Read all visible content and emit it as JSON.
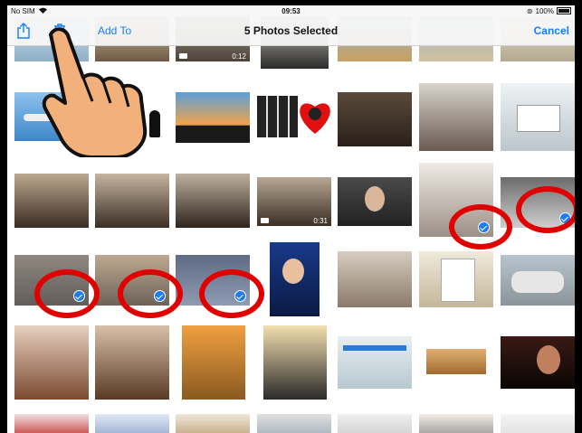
{
  "status": {
    "carrier": "No SIM",
    "time": "09:53",
    "battery": "100%"
  },
  "navbar": {
    "add_label": "Add To",
    "title": "5 Photos Selected",
    "cancel_label": "Cancel",
    "share_icon": "share-icon",
    "trash_icon": "trash-icon"
  },
  "videos": [
    {
      "duration": "0:12"
    },
    {
      "duration": "0:31"
    }
  ],
  "selection_count": 5,
  "colors": {
    "accent": "#147efb",
    "check": "#1e7cf2",
    "annotation_ring": "#e10000"
  }
}
